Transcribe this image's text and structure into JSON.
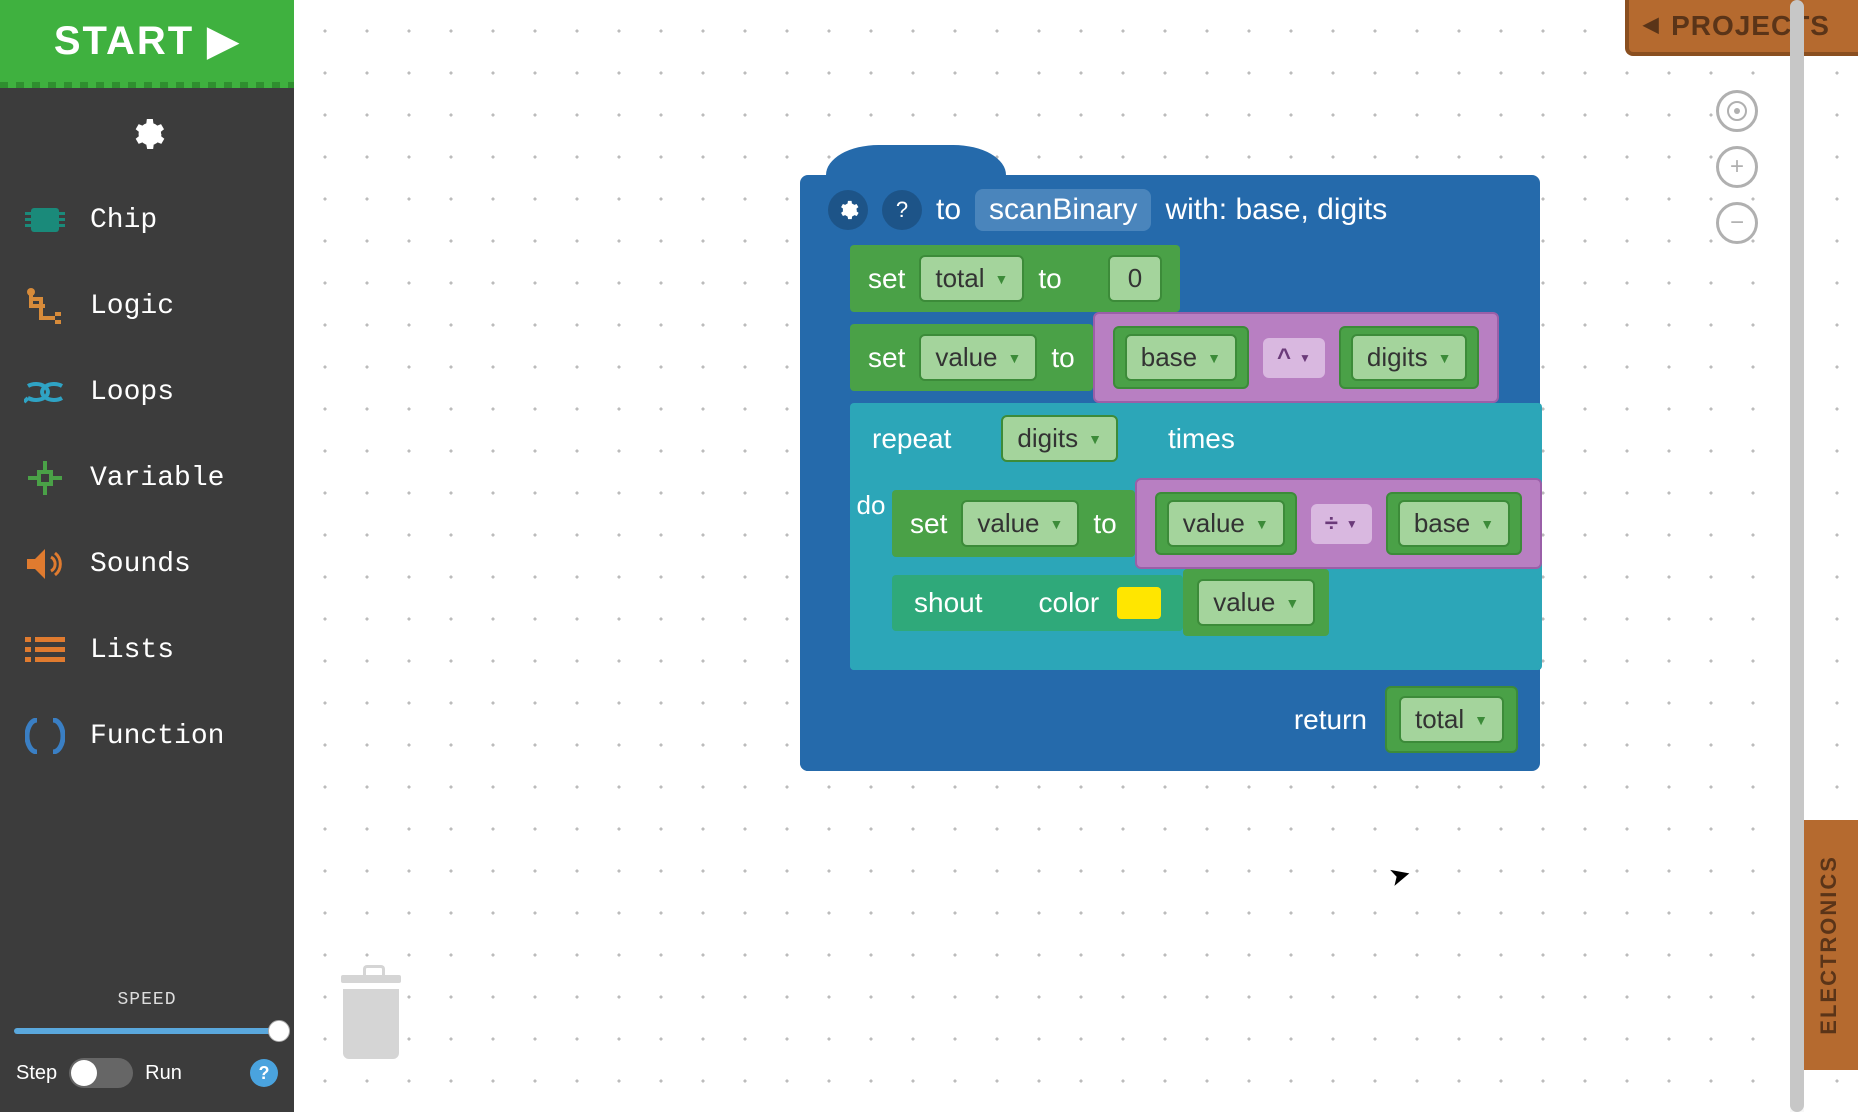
{
  "sidebar": {
    "start_label": "START ▶",
    "categories": [
      {
        "name": "chip",
        "label": "Chip",
        "color": "#1a8a7a"
      },
      {
        "name": "logic",
        "label": "Logic",
        "color": "#d78b3a"
      },
      {
        "name": "loops",
        "label": "Loops",
        "color": "#2fa3c4"
      },
      {
        "name": "variable",
        "label": "Variable",
        "color": "#4aa147"
      },
      {
        "name": "sounds",
        "label": "Sounds",
        "color": "#e07b2f"
      },
      {
        "name": "lists",
        "label": "Lists",
        "color": "#e07b2f"
      },
      {
        "name": "function",
        "label": "Function",
        "color": "#3a7fc4"
      }
    ],
    "speed_label": "SPEED",
    "step_label": "Step",
    "run_label": "Run",
    "help_label": "?"
  },
  "tabs": {
    "projects": "PROJECTS",
    "electronics": "ELECTRONICS"
  },
  "blocks": {
    "func": {
      "to_label": "to",
      "name": "scanBinary",
      "with_label": "with: base, digits",
      "return_label": "return",
      "return_var": "total"
    },
    "set1": {
      "set": "set",
      "var": "total",
      "to": "to",
      "value": "0"
    },
    "set2": {
      "set": "set",
      "var": "value",
      "to": "to",
      "op": "^",
      "a": "base",
      "b": "digits"
    },
    "repeat": {
      "repeat": "repeat",
      "var": "digits",
      "times": "times",
      "do": "do"
    },
    "set3": {
      "set": "set",
      "var": "value",
      "to": "to",
      "op": "÷",
      "a": "value",
      "b": "base"
    },
    "shout": {
      "shout": "shout",
      "color": "color",
      "var": "value",
      "swatch": "#ffe600"
    }
  },
  "zoom": {
    "center": "⊙",
    "in": "+",
    "out": "−"
  }
}
